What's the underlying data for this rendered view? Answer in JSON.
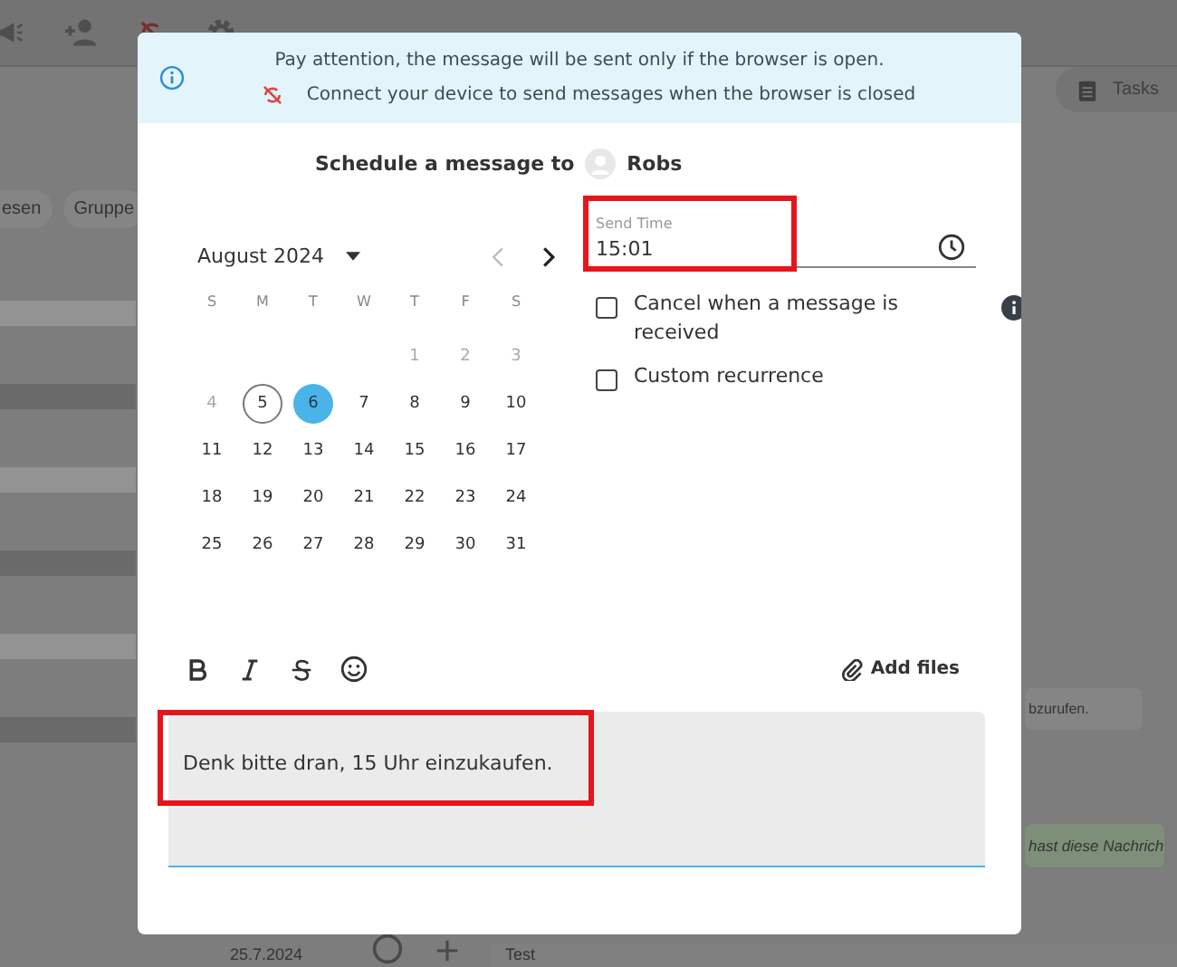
{
  "background": {
    "chips": [
      "esen",
      "Gruppe"
    ],
    "tasks_button": "Tasks",
    "messages": [
      {
        "text": "bzurufen.",
        "kind": "received"
      },
      {
        "text": "hast diese Nachrich",
        "kind": "sent"
      }
    ],
    "date": "25.7.2024",
    "composer_text": "Test"
  },
  "dialog": {
    "notice": {
      "line_1": "Pay attention, the message will be sent only if the browser is open.",
      "line_2": "Connect your device to send messages when the browser is closed"
    },
    "title": "Schedule a message to",
    "recipient": "Robs",
    "calendar": {
      "month": "August 2024",
      "weekdays": [
        "S",
        "M",
        "T",
        "W",
        "T",
        "F",
        "S"
      ],
      "weeks": [
        [
          {
            "kind": "blank"
          },
          {
            "kind": "blank"
          },
          {
            "kind": "blank"
          },
          {
            "kind": "blank"
          },
          {
            "kind": "day",
            "label": "1",
            "disabled": true,
            "today": false,
            "selected": false
          },
          {
            "kind": "day",
            "label": "2",
            "disabled": true,
            "today": false,
            "selected": false
          },
          {
            "kind": "day",
            "label": "3",
            "disabled": true,
            "today": false,
            "selected": false
          }
        ],
        [
          {
            "kind": "day",
            "label": "4",
            "disabled": true,
            "today": false,
            "selected": false
          },
          {
            "kind": "day",
            "label": "5",
            "disabled": false,
            "today": true,
            "selected": false
          },
          {
            "kind": "day",
            "label": "6",
            "disabled": false,
            "today": false,
            "selected": true
          },
          {
            "kind": "day",
            "label": "7",
            "disabled": false,
            "today": false,
            "selected": false
          },
          {
            "kind": "day",
            "label": "8",
            "disabled": false,
            "today": false,
            "selected": false
          },
          {
            "kind": "day",
            "label": "9",
            "disabled": false,
            "today": false,
            "selected": false
          },
          {
            "kind": "day",
            "label": "10",
            "disabled": false,
            "today": false,
            "selected": false
          }
        ],
        [
          {
            "kind": "day",
            "label": "11",
            "disabled": false,
            "today": false,
            "selected": false
          },
          {
            "kind": "day",
            "label": "12",
            "disabled": false,
            "today": false,
            "selected": false
          },
          {
            "kind": "day",
            "label": "13",
            "disabled": false,
            "today": false,
            "selected": false
          },
          {
            "kind": "day",
            "label": "14",
            "disabled": false,
            "today": false,
            "selected": false
          },
          {
            "kind": "day",
            "label": "15",
            "disabled": false,
            "today": false,
            "selected": false
          },
          {
            "kind": "day",
            "label": "16",
            "disabled": false,
            "today": false,
            "selected": false
          },
          {
            "kind": "day",
            "label": "17",
            "disabled": false,
            "today": false,
            "selected": false
          }
        ],
        [
          {
            "kind": "day",
            "label": "18",
            "disabled": false,
            "today": false,
            "selected": false
          },
          {
            "kind": "day",
            "label": "19",
            "disabled": false,
            "today": false,
            "selected": false
          },
          {
            "kind": "day",
            "label": "20",
            "disabled": false,
            "today": false,
            "selected": false
          },
          {
            "kind": "day",
            "label": "21",
            "disabled": false,
            "today": false,
            "selected": false
          },
          {
            "kind": "day",
            "label": "22",
            "disabled": false,
            "today": false,
            "selected": false
          },
          {
            "kind": "day",
            "label": "23",
            "disabled": false,
            "today": false,
            "selected": false
          },
          {
            "kind": "day",
            "label": "24",
            "disabled": false,
            "today": false,
            "selected": false
          }
        ],
        [
          {
            "kind": "day",
            "label": "25",
            "disabled": false,
            "today": false,
            "selected": false
          },
          {
            "kind": "day",
            "label": "26",
            "disabled": false,
            "today": false,
            "selected": false
          },
          {
            "kind": "day",
            "label": "27",
            "disabled": false,
            "today": false,
            "selected": false
          },
          {
            "kind": "day",
            "label": "28",
            "disabled": false,
            "today": false,
            "selected": false
          },
          {
            "kind": "day",
            "label": "29",
            "disabled": false,
            "today": false,
            "selected": false
          },
          {
            "kind": "day",
            "label": "30",
            "disabled": false,
            "today": false,
            "selected": false
          },
          {
            "kind": "day",
            "label": "31",
            "disabled": false,
            "today": false,
            "selected": false
          }
        ]
      ],
      "prev_disabled": true
    },
    "send_time": {
      "label": "Send Time",
      "value": "15:01",
      "highlighted": true
    },
    "options": [
      {
        "label": "Cancel when a message is received",
        "checked": false
      },
      {
        "label": "Custom recurrence",
        "checked": false
      }
    ],
    "add_files": "Add files",
    "message": {
      "value": "Denk bitte dran, 15 Uhr einzukaufen.",
      "highlighted": true
    }
  }
}
